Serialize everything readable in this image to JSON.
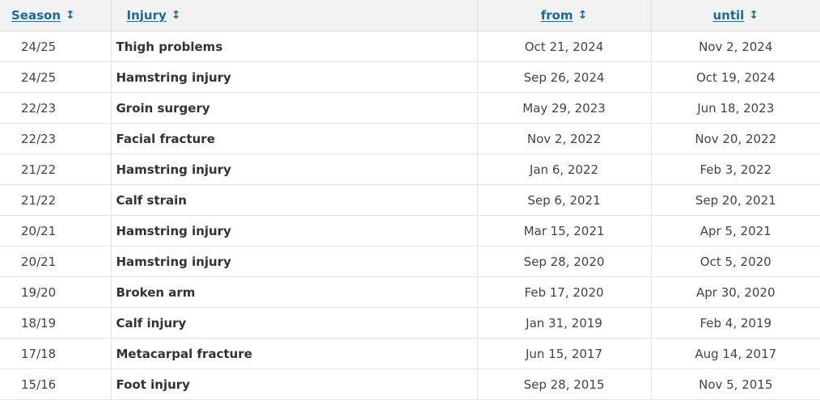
{
  "table": {
    "headers": {
      "season": "Season",
      "injury": "Injury",
      "from": "from",
      "until": "until"
    },
    "sort_glyph": "↕",
    "rows": [
      {
        "season": "24/25",
        "injury": "Thigh problems",
        "from": "Oct 21, 2024",
        "until": "Nov 2, 2024"
      },
      {
        "season": "24/25",
        "injury": "Hamstring injury",
        "from": "Sep 26, 2024",
        "until": "Oct 19, 2024"
      },
      {
        "season": "22/23",
        "injury": "Groin surgery",
        "from": "May 29, 2023",
        "until": "Jun 18, 2023"
      },
      {
        "season": "22/23",
        "injury": "Facial fracture",
        "from": "Nov 2, 2022",
        "until": "Nov 20, 2022"
      },
      {
        "season": "21/22",
        "injury": "Hamstring injury",
        "from": "Jan 6, 2022",
        "until": "Feb 3, 2022"
      },
      {
        "season": "21/22",
        "injury": "Calf strain",
        "from": "Sep 6, 2021",
        "until": "Sep 20, 2021"
      },
      {
        "season": "20/21",
        "injury": "Hamstring injury",
        "from": "Mar 15, 2021",
        "until": "Apr 5, 2021"
      },
      {
        "season": "20/21",
        "injury": "Hamstring injury",
        "from": "Sep 28, 2020",
        "until": "Oct 5, 2020"
      },
      {
        "season": "19/20",
        "injury": "Broken arm",
        "from": "Feb 17, 2020",
        "until": "Apr 30, 2020"
      },
      {
        "season": "18/19",
        "injury": "Calf injury",
        "from": "Jan 31, 2019",
        "until": "Feb 4, 2019"
      },
      {
        "season": "17/18",
        "injury": "Metacarpal fracture",
        "from": "Jun 15, 2017",
        "until": "Aug 14, 2017"
      },
      {
        "season": "15/16",
        "injury": "Foot injury",
        "from": "Sep 28, 2015",
        "until": "Nov 5, 2015"
      }
    ]
  }
}
